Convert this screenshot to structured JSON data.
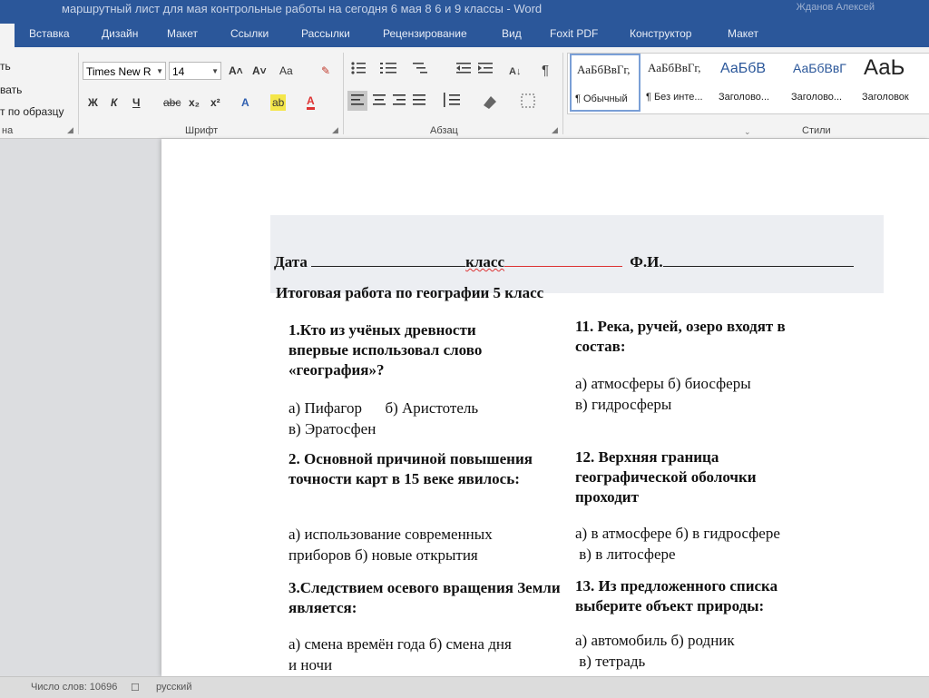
{
  "title_bar": {
    "title": "маршрутный лист для мая контрольные работы на сегодня 6 мая 8 6 и 9 классы - Word",
    "user": "Жданов Алексей"
  },
  "ribbon_tabs": [
    "Вставка",
    "Дизайн",
    "Макет",
    "Ссылки",
    "Рассылки",
    "Рецензирование",
    "Вид",
    "Foxit PDF",
    "Конструктор",
    "Макет"
  ],
  "clipboard": {
    "items": [
      "ть",
      "вать",
      "т по образцу"
    ],
    "group_label": "на"
  },
  "font": {
    "family": "Times New R",
    "size": "14",
    "grow": "A˄",
    "shrink": "A˅",
    "case": "Aa",
    "clear": "✎",
    "bold": "Ж",
    "italic": "К",
    "underline": "Ч",
    "strike": "abc",
    "subscript": "x₂",
    "superscript": "x²",
    "effects": "A",
    "highlight": "ab",
    "color": "A",
    "group_label": "Шрифт"
  },
  "paragraph": {
    "group_label": "Абзац"
  },
  "styles": {
    "items": [
      {
        "sample": "АаБбВвГг,",
        "name": "¶ Обычный"
      },
      {
        "sample": "АаБбВвГг,",
        "name": "¶ Без инте..."
      },
      {
        "sample": "АаБбВ",
        "name": "Заголово..."
      },
      {
        "sample": "АаБбВвГ",
        "name": "Заголово..."
      },
      {
        "sample": "АаЬ",
        "name": "Заголовок"
      }
    ],
    "group_label": "Стили"
  },
  "document": {
    "date_label": "Дата",
    "class_label": "класс",
    "fio_label": "Ф.И.",
    "heading": "Итоговая работа по географии 5 класс",
    "left_column": [
      {
        "question": "1.Кто из учёных древности впервые использовал слово «география»?",
        "answer": [
          "а) Пифагор      б) Аристотель",
          "в) Эратосфен"
        ]
      },
      {
        "question": "2. Основной причиной повышения точности карт в 15 веке явилось:",
        "answer": [
          "а) использование современных",
          "приборов б) новые открытия"
        ]
      },
      {
        "question": "3.Следствием осевого вращения Земли является:",
        "answer": [
          "а) смена времён года б) смена дня",
          "и ночи"
        ]
      }
    ],
    "right_column": [
      {
        "question": "11. Река, ручей, озеро входят в состав:",
        "answer": [
          "а) атмосферы б) биосферы",
          "в) гидросферы"
        ]
      },
      {
        "question": "12. Верхняя граница географической оболочки проходит",
        "answer": [
          "а) в атмосфере б) в гидросфере",
          " в) в литосфере"
        ]
      },
      {
        "question": "13. Из предложенного списка выберите объект природы:",
        "answer": [
          "а) автомобиль б) родник",
          " в) тетрадь"
        ]
      }
    ]
  },
  "status_bar": {
    "word_count": "Число слов: 10696",
    "language": "русский"
  }
}
